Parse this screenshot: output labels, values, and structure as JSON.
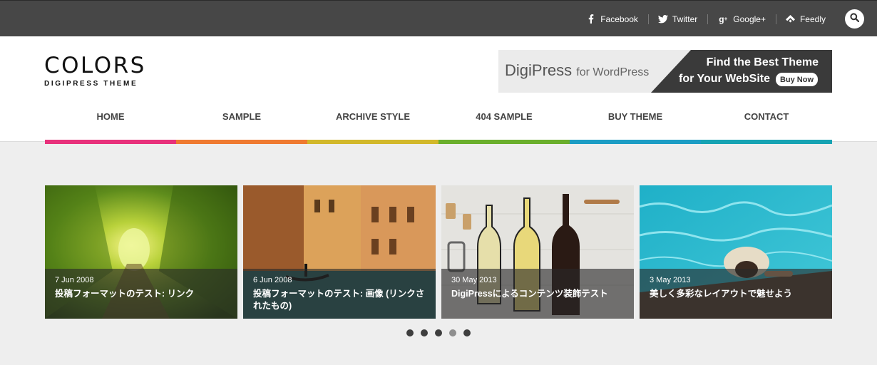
{
  "topbar": {
    "social": [
      {
        "label": "Facebook",
        "icon": "facebook-icon"
      },
      {
        "label": "Twitter",
        "icon": "twitter-icon"
      },
      {
        "label": "Google+",
        "icon": "googleplus-icon"
      },
      {
        "label": "Feedly",
        "icon": "feedly-icon"
      }
    ],
    "search_icon": "search-icon"
  },
  "header": {
    "logo_title": "COLORS",
    "logo_subtitle": "DIGIPRESS THEME",
    "banner": {
      "brand": "DigiPress",
      "brand_suffix": "for WordPress",
      "line1": "Find the Best Theme",
      "line2": "for Your WebSite",
      "button": "Buy Now"
    }
  },
  "nav": {
    "items": [
      "HOME",
      "SAMPLE",
      "ARCHIVE STYLE",
      "404 SAMPLE",
      "BUY THEME",
      "CONTACT"
    ],
    "stripe_colors": [
      "#e8317b",
      "#ef7a30",
      "#d2b82a",
      "#6aae2c",
      "#1b9cc4",
      "#16a3b3"
    ]
  },
  "slider": {
    "slides": [
      {
        "date": "7 Jun 2008",
        "title": "投稿フォーマットのテスト: リンク"
      },
      {
        "date": "6 Jun 2008",
        "title": "投稿フォーマットのテスト: 画像 (リンクされたもの)"
      },
      {
        "date": "30 May 2013",
        "title": "DigiPressによるコンテンツ装飾テスト"
      },
      {
        "date": "3 May 2013",
        "title": "美しく多彩なレイアウトで魅せよう"
      }
    ],
    "dots": 5,
    "active_dot": 4
  },
  "colors": {
    "topbar": "#474747",
    "banner_dark": "#3a3a3a",
    "page_bg": "#eeeeee"
  }
}
